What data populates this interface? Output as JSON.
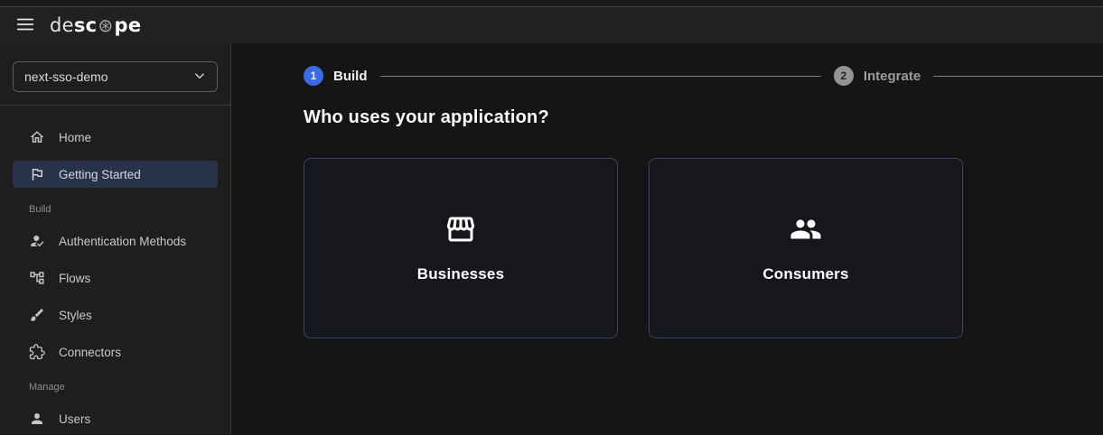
{
  "header": {
    "logo_de": "de",
    "logo_sc": "sc",
    "logo_o": "⊛",
    "logo_pe": "pe"
  },
  "sidebar": {
    "project": "next-sso-demo",
    "nav": [
      {
        "label": "Home",
        "icon": "home-icon"
      },
      {
        "label": "Getting Started",
        "icon": "flag-icon"
      }
    ],
    "build_section": {
      "label": "Build",
      "items": [
        {
          "label": "Authentication Methods",
          "icon": "person-check-icon"
        },
        {
          "label": "Flows",
          "icon": "flow-tree-icon"
        },
        {
          "label": "Styles",
          "icon": "brush-icon"
        },
        {
          "label": "Connectors",
          "icon": "puzzle-icon"
        }
      ]
    },
    "manage_section": {
      "label": "Manage",
      "items": [
        {
          "label": "Users",
          "icon": "person-icon"
        }
      ]
    }
  },
  "main": {
    "stepper": {
      "steps": [
        {
          "number": "1",
          "label": "Build",
          "state": "active"
        },
        {
          "number": "2",
          "label": "Integrate",
          "state": "inactive"
        }
      ]
    },
    "heading": "Who uses your application?",
    "cards": [
      {
        "label": "Businesses",
        "icon": "storefront-icon"
      },
      {
        "label": "Consumers",
        "icon": "group-icon"
      }
    ]
  },
  "colors": {
    "accent_blue": "#3b6ce5",
    "inactive_step_gray": "#939393",
    "active_nav_bg": "#283248",
    "card_border": "#3a4366",
    "sidebar_bg": "#1e1e1e",
    "header_bg": "#212121",
    "main_bg": "#151515"
  }
}
